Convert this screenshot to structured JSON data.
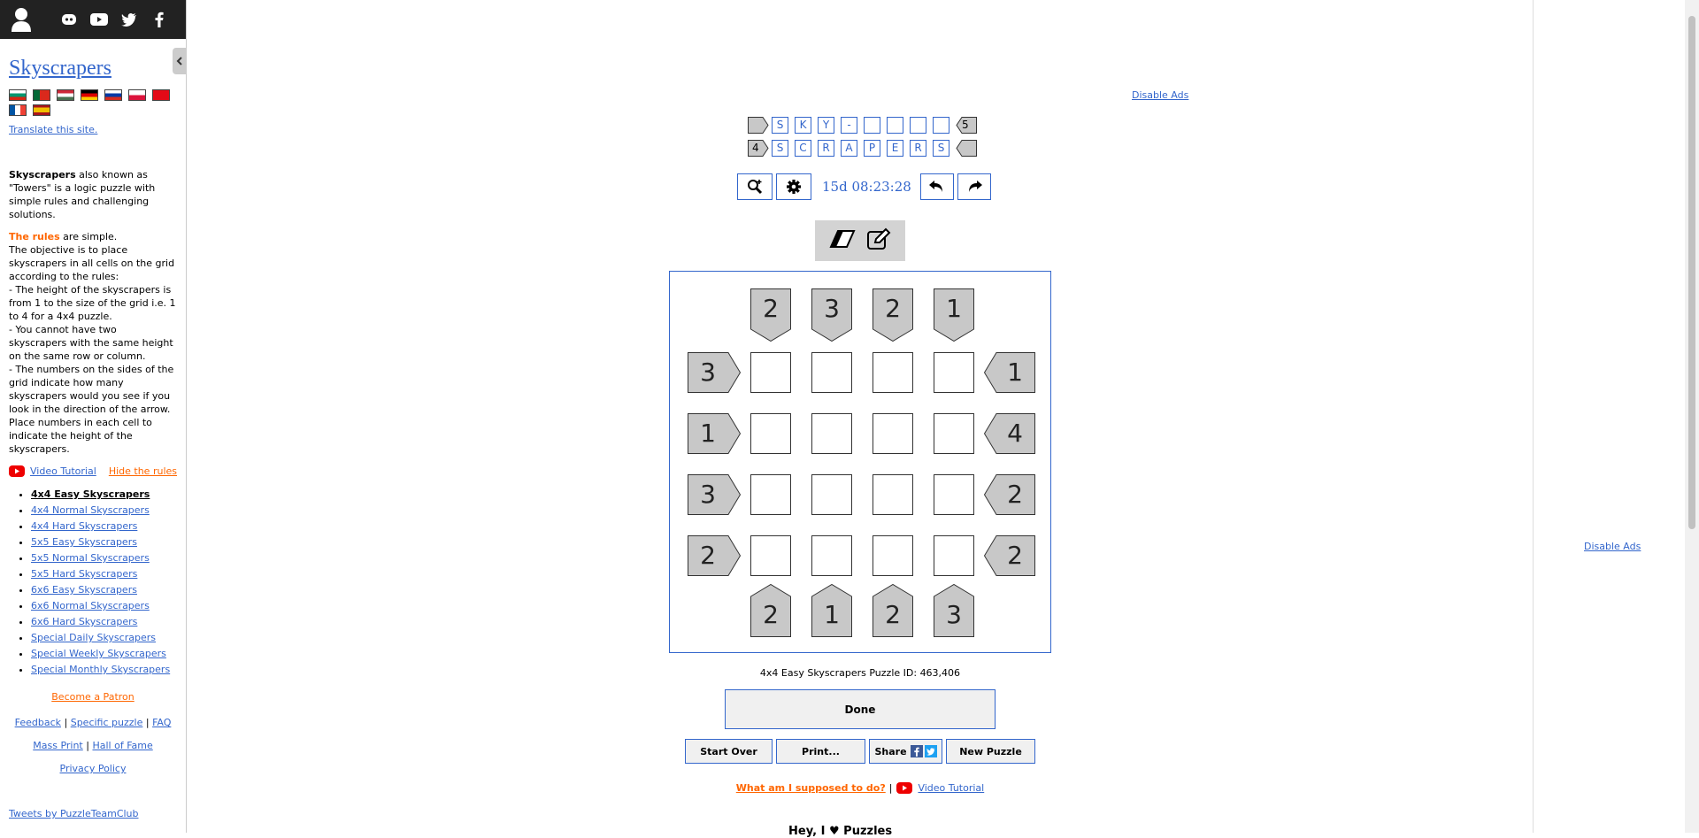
{
  "sidebar": {
    "title": "Skyscrapers",
    "translate": "Translate this site.",
    "intro_bold": "Skyscrapers",
    "intro_text": " also known as \"Towers\" is a logic puzzle with simple rules and challenging solutions.",
    "rules_hl": "The rules",
    "rules_intro": " are simple.",
    "rules_lines": [
      "The objective is to place skyscrapers in all cells on the grid according to the rules:",
      "- The height of the skyscrapers is from 1 to the size of the grid i.e. 1 to 4 for a 4x4 puzzle.",
      "- You cannot have two skyscrapers with the same height on the same row or column.",
      "- The numbers on the sides of the grid indicate how many skyscrapers would you see if you look in the direction of the arrow.",
      "Place numbers in each cell to indicate the height of the skyscrapers."
    ],
    "video_tutorial": "Video Tutorial",
    "hide_rules": "Hide the rules",
    "puzzles": [
      "4x4 Easy Skyscrapers",
      "4x4 Normal Skyscrapers",
      "4x4 Hard Skyscrapers",
      "5x5 Easy Skyscrapers",
      "5x5 Normal Skyscrapers",
      "5x5 Hard Skyscrapers",
      "6x6 Easy Skyscrapers",
      "6x6 Normal Skyscrapers",
      "6x6 Hard Skyscrapers",
      "Special Daily Skyscrapers",
      "Special Weekly Skyscrapers",
      "Special Monthly Skyscrapers"
    ],
    "patron": "Become a Patron",
    "feedback": "Feedback",
    "specific": "Specific puzzle",
    "faq": "FAQ",
    "mass_print": "Mass Print",
    "hall_of_fame": "Hall of Fame",
    "privacy": "Privacy Policy",
    "tweets": "Tweets by PuzzleTeamClub",
    "sep": "|"
  },
  "ads": {
    "disable": "Disable Ads"
  },
  "logo": {
    "row1": [
      "S",
      "K",
      "Y",
      "-",
      "",
      "",
      "",
      ""
    ],
    "row1_right_clue": "5",
    "row2_left_clue": "4",
    "row2": [
      "S",
      "C",
      "R",
      "A",
      "P",
      "E",
      "R",
      "S"
    ]
  },
  "toolbar": {
    "timer": "15d 08:23:28"
  },
  "clues": {
    "top": [
      "2",
      "3",
      "2",
      "1"
    ],
    "bottom": [
      "2",
      "1",
      "2",
      "3"
    ],
    "left": [
      "3",
      "1",
      "3",
      "2"
    ],
    "right": [
      "1",
      "4",
      "2",
      "2"
    ]
  },
  "puzzle": {
    "id_label": "4x4 Easy Skyscrapers Puzzle ID: 463,406",
    "done": "Done",
    "start_over": "Start Over",
    "print": "Print...",
    "share": "Share",
    "new_puzzle": "New Puzzle",
    "help": "What am I supposed to do?",
    "video_tutorial": "Video Tutorial",
    "sep": "|",
    "next_heading": "Hey, I ♥ Puzzles"
  },
  "colors": {
    "link": "#3366cc",
    "accent": "#ff6600",
    "clue_fill": "#c8c8c8",
    "topbar": "#222222"
  }
}
